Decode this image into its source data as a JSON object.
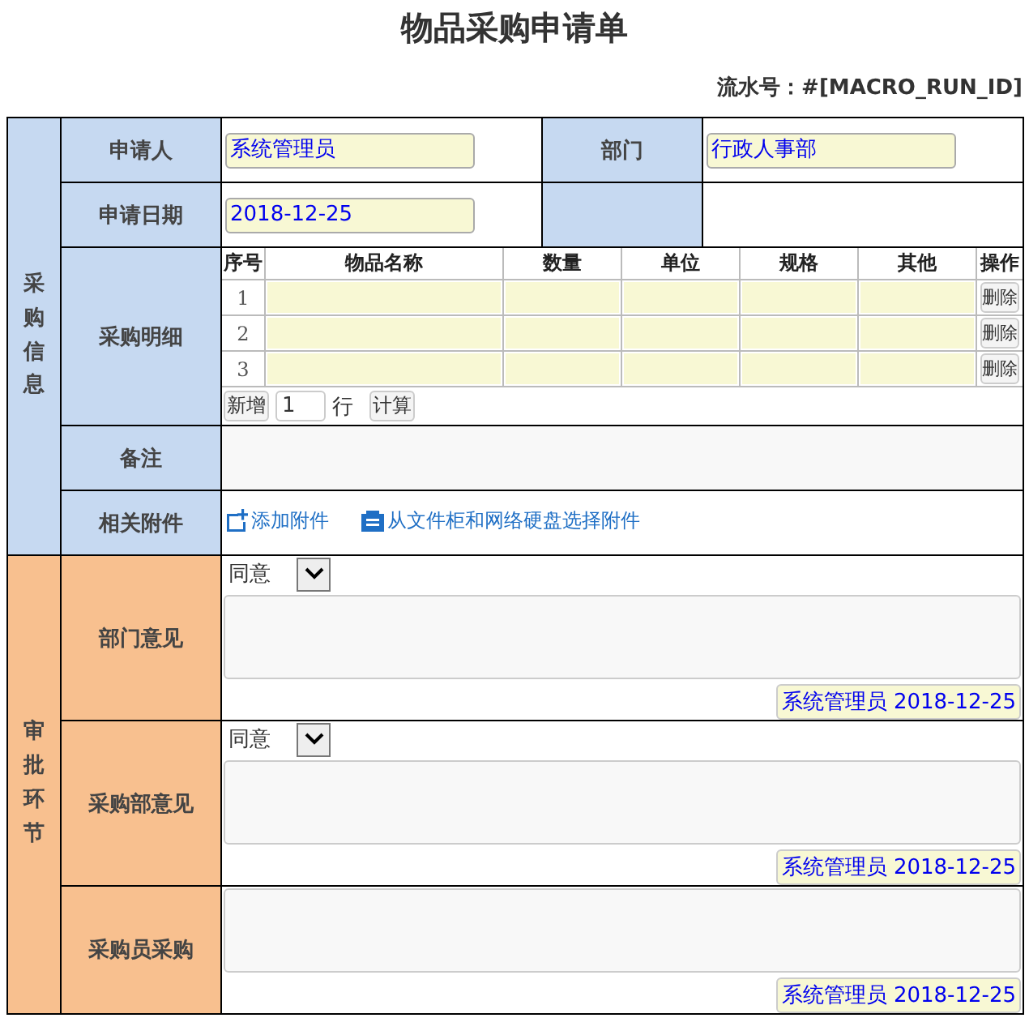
{
  "title": "物品采购申请单",
  "serial_number": "流水号：#[MACRO_RUN_ID]",
  "purchase_info": {
    "title": "采购信息",
    "applicant": {
      "label": "申请人",
      "value": "系统管理员"
    },
    "department": {
      "label": "部门",
      "value": "行政人事部"
    },
    "apply_date": {
      "label": "申请日期",
      "value": "2018-12-25"
    },
    "details": {
      "label": "采购明细",
      "columns": [
        "序号",
        "物品名称",
        "数量",
        "单位",
        "规格",
        "其他",
        "操作"
      ],
      "rows": [
        {
          "index": "1",
          "action": "删除"
        },
        {
          "index": "2",
          "action": "删除"
        },
        {
          "index": "3",
          "action": "删除"
        }
      ],
      "add_button": "新增",
      "add_count": "1",
      "add_unit": "行",
      "calc_button": "计算"
    },
    "remarks": {
      "label": "备注"
    },
    "attachments": {
      "label": "相关附件",
      "links": [
        {
          "kind": "add",
          "text": "添加附件"
        },
        {
          "kind": "select",
          "text": "从文件柜和网络硬盘选择附件"
        }
      ]
    }
  },
  "approval": {
    "title": "审批环节",
    "steps": [
      {
        "label": "部门意见",
        "decision": "同意",
        "signature": "系统管理员 2018-12-25"
      },
      {
        "label": "采购部意见",
        "decision": "同意",
        "signature": "系统管理员 2018-12-25"
      },
      {
        "label": "采购员采购",
        "signature": "系统管理员 2018-12-25"
      }
    ]
  }
}
